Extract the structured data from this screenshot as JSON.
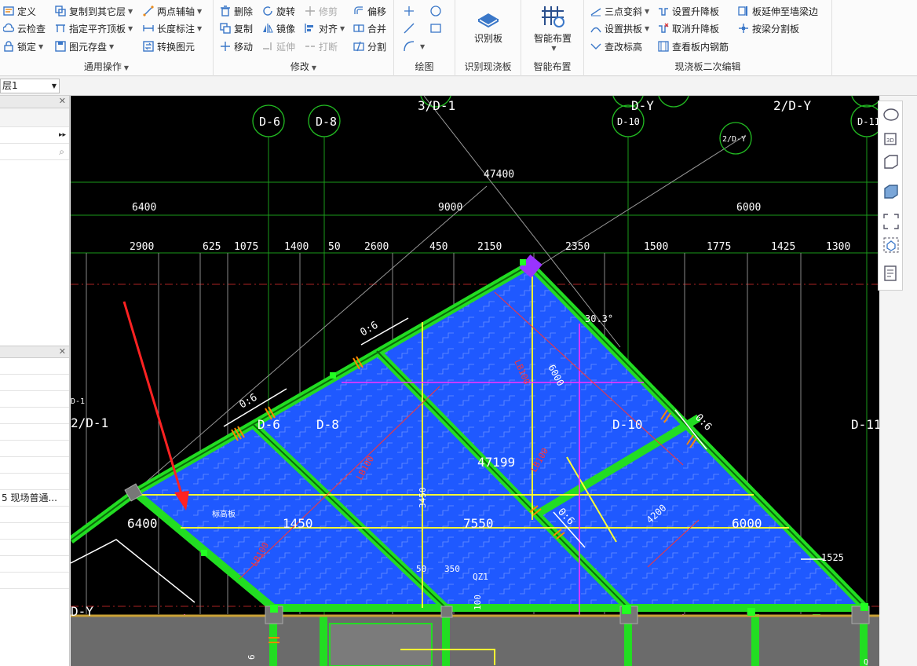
{
  "ribbon": {
    "general": {
      "label": "通用操作",
      "define": "定义",
      "cloud_check": "云检查",
      "lock": "锁定",
      "copy_to_layer": "复制到其它层",
      "align_roof": "指定平齐顶板",
      "save_element": "图元存盘",
      "two_point_axis": "两点辅轴",
      "length_dim": "长度标注",
      "convert_element": "转换图元"
    },
    "modify": {
      "label": "修改",
      "delete": "删除",
      "rotate": "旋转",
      "trim": "修剪",
      "offset": "偏移",
      "copy": "复制",
      "mirror": "镜像",
      "align": "对齐",
      "merge": "合并",
      "move": "移动",
      "extend": "延伸",
      "break": "打断",
      "split": "分割"
    },
    "draw": {
      "label": "绘图"
    },
    "recognize": {
      "label": "识别现浇板",
      "button": "识别板"
    },
    "smart": {
      "label": "智能布置",
      "button": "智能布置"
    },
    "secondary": {
      "label": "现浇板二次编辑",
      "three_point_slope": "三点变斜",
      "set_arch": "设置拱板",
      "check_elevation": "查改标高",
      "set_raise": "设置升降板",
      "cancel_raise": "取消升降板",
      "view_rebar": "查看板内钢筋",
      "extend_to_beam": "板延伸至墙梁边",
      "split_by_beam": "按梁分割板"
    }
  },
  "layer_select": {
    "value": "层1"
  },
  "left_panel": {
    "row_text": "5  现场普通..."
  },
  "cad": {
    "axes": {
      "top": [
        "D-6",
        "D-8",
        "D-10",
        "D-11"
      ],
      "top_diag": [
        "3/D-1",
        "D-Y",
        "2/D-Y"
      ],
      "circle_2dy": "2/D-Y",
      "left_2d1": "2/D-1",
      "left_d1": "D-1",
      "mid": [
        "D-6",
        "D-8",
        "D-10",
        "D-11"
      ],
      "bottom": "D-Y"
    },
    "dims": {
      "total": "47400",
      "row1": [
        "6400",
        "9000",
        "6000"
      ],
      "row2": [
        "2900",
        "625",
        "1075",
        "1400",
        "50",
        "2600",
        "450",
        "2150",
        "2350",
        "1500",
        "1775",
        "1425",
        "1300"
      ]
    },
    "labels": {
      "angle": "30.3°",
      "slope": "0:6",
      "mid_dim": "47199",
      "d6400": "6400",
      "d1450": "1450",
      "d7550": "7550",
      "d6000": "6000",
      "d1525": "1525",
      "d6000b": "6000",
      "d4200": "4200",
      "d3450": "3450",
      "d50": "50",
      "d350": "350",
      "d100": "100",
      "qz1": "QZ1",
      "text_small": "标高板",
      "d6b": "6",
      "dq": "Q",
      "slab_1": "LB100",
      "slab_2": "LB100",
      "slab_3": "LB100",
      "slab_4": "LB100"
    }
  },
  "colors": {
    "canvas": "#000000",
    "slab": "#1f59ff",
    "beam": "#22dd22",
    "axis": "#22bb22",
    "dim": "#ffffff",
    "yellow": "#ffff33",
    "magenta": "#ff33ff",
    "red": "#ff3333"
  }
}
